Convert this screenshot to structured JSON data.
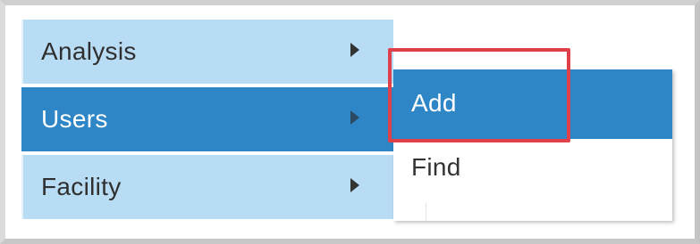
{
  "menu": {
    "items": [
      {
        "label": "Analysis",
        "active": false
      },
      {
        "label": "Users",
        "active": true
      },
      {
        "label": "Facility",
        "active": false
      }
    ]
  },
  "submenu": {
    "items": [
      {
        "label": "Add",
        "highlighted": true
      },
      {
        "label": "Find",
        "highlighted": false
      }
    ]
  },
  "colors": {
    "menu_bg": "#b9dcf5",
    "active_bg": "#2e86c6",
    "highlight_border": "#e0404a"
  },
  "icons": {
    "submenu_arrow": "caret-right-icon"
  }
}
